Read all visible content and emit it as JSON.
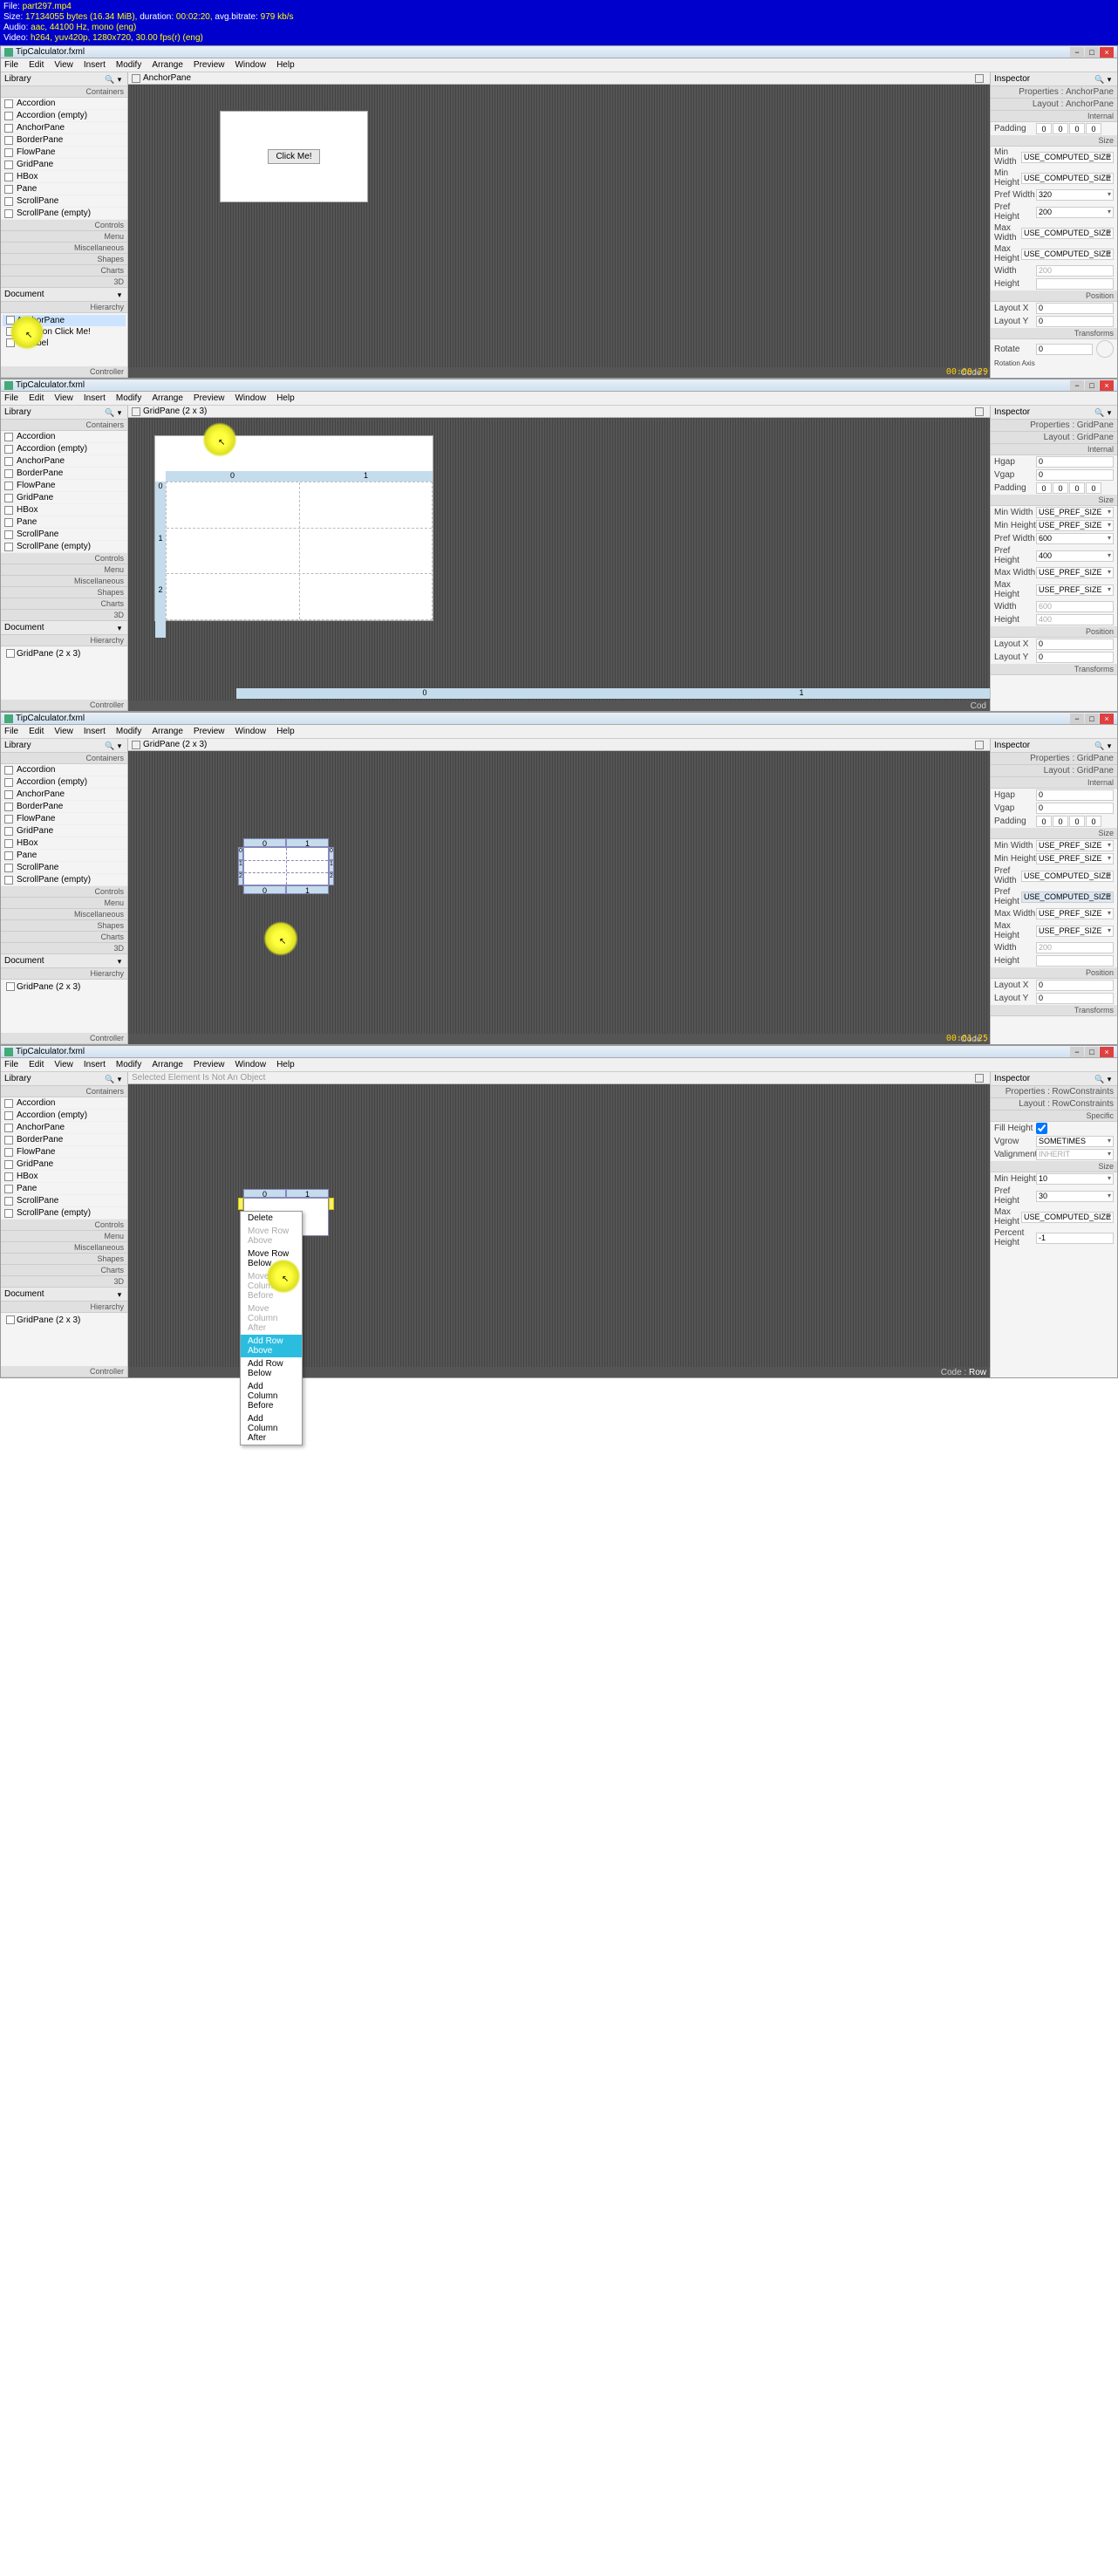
{
  "file_info": {
    "line1_a": "File: ",
    "line1_b": "part297.mp4",
    "line2_a": "Size: ",
    "line2_b": "17134055 bytes (16.34 MiB), ",
    "line2_c": "duration: ",
    "line2_d": "00:02:20, ",
    "line2_e": "avg.bitrate: ",
    "line2_f": "979 kb/s",
    "line3_a": "Audio: ",
    "line3_b": "aac, 44100 Hz, mono (eng)",
    "line4_a": "Video: ",
    "line4_b": "h264, yuv420p, 1280x720, 30.00 fps(r) (eng)"
  },
  "menu": [
    "File",
    "Edit",
    "View",
    "Insert",
    "Modify",
    "Arrange",
    "Preview",
    "Window",
    "Help"
  ],
  "library_label": "Library",
  "inspector_label": "Inspector",
  "document_label": "Document",
  "sections": {
    "containers": "Containers",
    "controls": "Controls",
    "menu": "Menu",
    "miscellaneous": "Miscellaneous",
    "shapes": "Shapes",
    "charts": "Charts",
    "3d": "3D",
    "hierarchy": "Hierarchy",
    "controller": "Controller",
    "properties": "Properties :",
    "layout": "Layout :",
    "code": "Code :",
    "internal": "Internal",
    "size": "Size",
    "position": "Position",
    "transforms": "Transforms",
    "specific": "Specific"
  },
  "lib_items_1": [
    "Accordion",
    "Accordion   (empty)",
    "AnchorPane",
    "BorderPane",
    "FlowPane",
    "GridPane",
    "HBox",
    "Pane",
    "ScrollPane",
    "ScrollPane   (empty)"
  ],
  "lib_items_2": [
    "Accordion",
    "Accordion   (empty)",
    "AnchorPane",
    "BorderPane",
    "FlowPane",
    "GridPane",
    "HBox",
    "Pane",
    "ScrollPane",
    "ScrollPane   (empty)"
  ],
  "pane1": {
    "title": "TipCalculator.fxml",
    "center_label": "AnchorPane",
    "button_text": "Click Me!",
    "tree": [
      "AnchorPane",
      "Button  Click Me!",
      "Label"
    ],
    "insp_type": "AnchorPane",
    "props": {
      "padding": [
        "0",
        "0",
        "0",
        "0"
      ],
      "minw": "USE_COMPUTED_SIZE",
      "minh": "USE_COMPUTED_SIZE",
      "prefw": "320",
      "prefh": "200",
      "maxw": "USE_COMPUTED_SIZE",
      "maxh": "USE_COMPUTED_SIZE",
      "width": "200",
      "height": "",
      "layoutx": "0",
      "layouty": "0",
      "rotate": "0"
    },
    "labels": {
      "padding": "Padding",
      "minw": "Min Width",
      "minh": "Min Height",
      "prefw": "Pref Width",
      "prefh": "Pref Height",
      "maxw": "Max Width",
      "maxh": "Max Height",
      "width": "Width",
      "height": "Height",
      "layoutx": "Layout X",
      "layouty": "Layout Y",
      "rotate": "Rotate",
      "rotaxis": "Rotation Axis"
    },
    "timestamp": "00:00:29",
    "code_footer": "Code :"
  },
  "pane2": {
    "title": "TipCalculator.fxml",
    "center_label": "GridPane (2 x 3)",
    "tree_item": "GridPane (2 x 3)",
    "insp_type": "GridPane",
    "col_labels": [
      "0",
      "1"
    ],
    "row_labels": [
      "0",
      "1",
      "2"
    ],
    "props": {
      "hgap": "0",
      "vgap": "0",
      "padding": [
        "0",
        "0",
        "0",
        "0"
      ],
      "minw": "USE_PREF_SIZE",
      "minh": "USE_PREF_SIZE",
      "prefw": "600",
      "prefh": "400",
      "maxw": "USE_PREF_SIZE",
      "maxh": "USE_PREF_SIZE",
      "width": "600",
      "height": "400",
      "layoutx": "0",
      "layouty": "0"
    },
    "labels": {
      "hgap": "Hgap",
      "vgap": "Vgap"
    },
    "code_footer": "Cod"
  },
  "pane3": {
    "title": "TipCalculator.fxml",
    "center_label": "GridPane (2 x 3)",
    "tree_item": "GridPane (2 x 3)",
    "insp_type": "GridPane",
    "col_labels": [
      "0",
      "1"
    ],
    "row_labels": [
      "0",
      "1",
      "2"
    ],
    "props": {
      "hgap": "0",
      "vgap": "0",
      "padding": [
        "0",
        "0",
        "0",
        "0"
      ],
      "minw": "USE_PREF_SIZE",
      "minh": "USE_PREF_SIZE",
      "prefw": "USE_COMPUTED_SIZE",
      "prefh": "USE_COMPUTED_SIZE",
      "maxw": "USE_PREF_SIZE",
      "maxh": "USE_PREF_SIZE",
      "width": "200",
      "height": "",
      "layoutx": "0",
      "layouty": "0"
    },
    "timestamp": "00:01:25",
    "code_footer": "Code :"
  },
  "pane4": {
    "title": "TipCalculator.fxml",
    "center_label": "Selected Element Is Not An Object",
    "tree_item": "GridPane (2 x 3)",
    "insp_type": "RowConstraints",
    "layout_type": "RowConstraints",
    "col_labels": [
      "0",
      "1"
    ],
    "props": {
      "fillh": "",
      "vgrow": "SOMETIMES",
      "valign": "INHERIT",
      "minh": "10",
      "prefh": "30",
      "maxh": "USE_COMPUTED_SIZE",
      "perch": "-1"
    },
    "labels": {
      "fillh": "Fill Height",
      "vgrow": "Vgrow",
      "valign": "Valignment",
      "minh": "Min Height",
      "prefh": "Pref Height",
      "maxh": "Max Height",
      "perch": "Percent Height"
    },
    "ctx_menu": [
      "Delete",
      "Move Row Above",
      "Move Row Below",
      "Move Column Before",
      "Move Column After",
      "Add Row Above",
      "Add Row Below",
      "Add Column Before",
      "Add Column After"
    ],
    "ctx_highlighted": 5,
    "code_footer": "Code : "
  }
}
